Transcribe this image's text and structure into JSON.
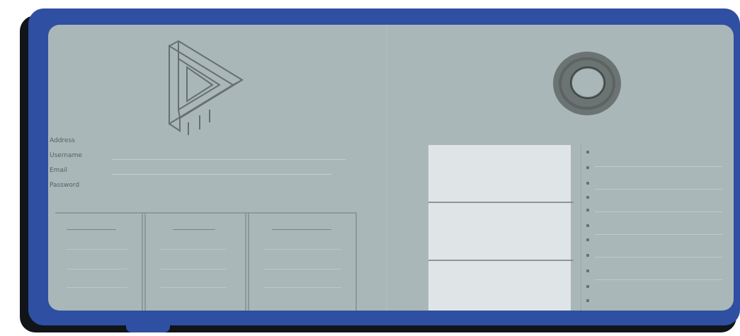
{
  "colors": {
    "frame": "#2f4fa3",
    "screen": "#a9b7b8"
  },
  "icons": {
    "logo": "impossible-triangle-logo",
    "ring": "donut-ring"
  },
  "form": {
    "labels": [
      "Address",
      "Username",
      "Email",
      "Password"
    ]
  },
  "cards": [
    {
      "title": ""
    },
    {
      "title": ""
    },
    {
      "title": ""
    }
  ]
}
